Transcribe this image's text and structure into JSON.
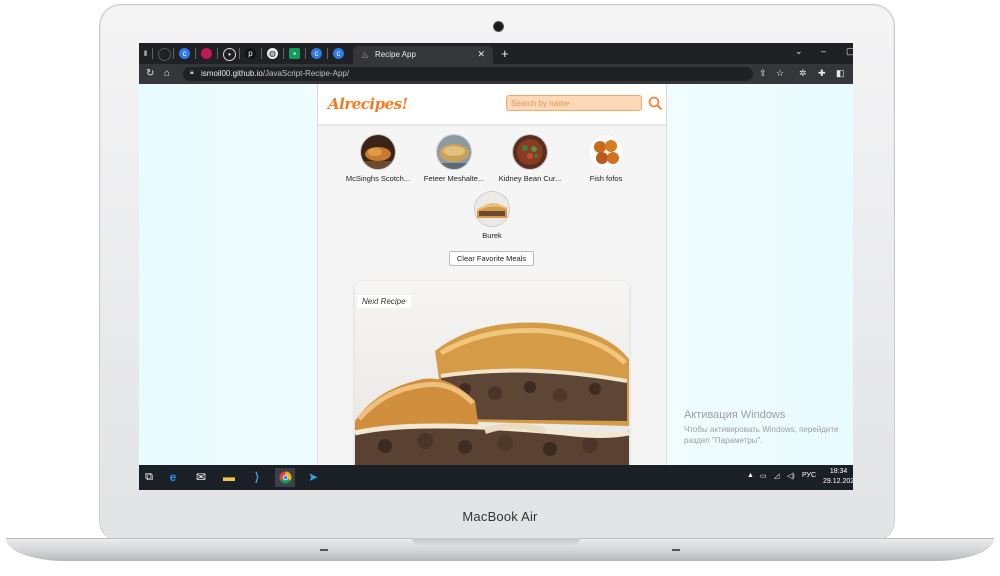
{
  "device": {
    "label": "MacBook Air"
  },
  "browser": {
    "active_tab_title": "Recipe App",
    "url_host": "ismoil00.github.io",
    "url_path": "/JavaScript-Recipe-App/"
  },
  "app": {
    "logo": "Alrecipes!",
    "search_placeholder": "Search by name",
    "favorites": [
      {
        "name": "McSinghs Scotch..."
      },
      {
        "name": "Feteer Meshalte..."
      },
      {
        "name": "Kidney Bean Cur..."
      },
      {
        "name": "Fish fofos"
      },
      {
        "name": "Burek"
      }
    ],
    "clear_button": "Clear Favorite Meals",
    "next_recipe_label": "Next Recipe"
  },
  "watermark": {
    "title": "Активация Windows",
    "line1": "Чтобы активировать Windows, перейдите",
    "line2": "раздел \"Параметры\"."
  },
  "taskbar": {
    "lang": "РУС",
    "time": "18:34",
    "date": "29.12.202"
  },
  "colors": {
    "accent": "#f47b20",
    "page_bg": "#f0fcff",
    "taskbar": "#1b1f26"
  }
}
